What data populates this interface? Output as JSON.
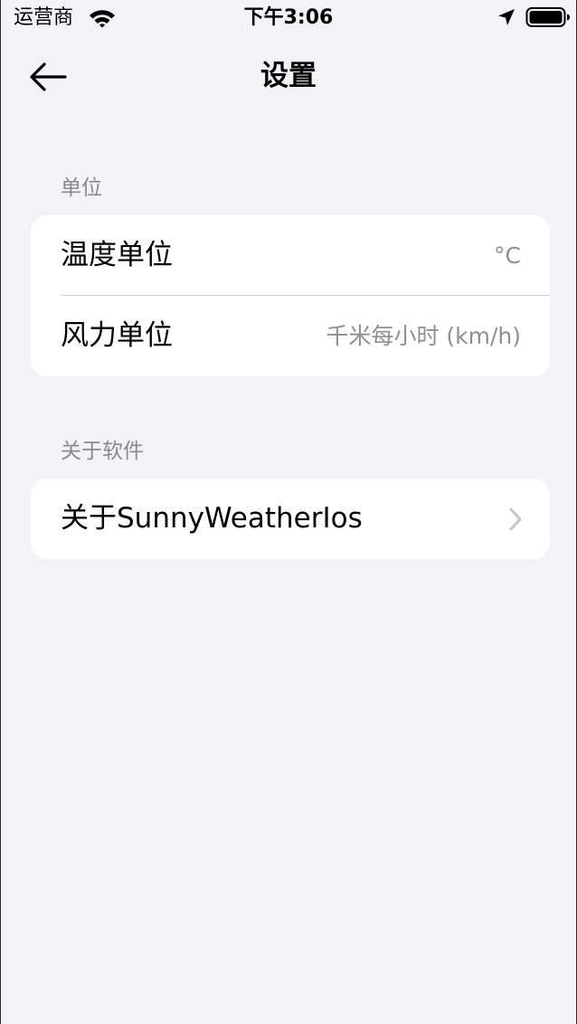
{
  "status_bar": {
    "carrier": "运营商",
    "time": "下午3:06"
  },
  "nav": {
    "title": "设置"
  },
  "sections": [
    {
      "header": "单位",
      "rows": [
        {
          "label": "温度单位",
          "value": "°C"
        },
        {
          "label": "风力单位",
          "value": "千米每小时 (km/h)"
        }
      ]
    },
    {
      "header": "关于软件",
      "rows": [
        {
          "label": "关于SunnyWeatherIos",
          "accessory": "chevron-right-icon"
        }
      ]
    }
  ],
  "colors": {
    "background": "#f2f2f7",
    "card": "#ffffff",
    "secondary_text": "#8e8e93"
  }
}
